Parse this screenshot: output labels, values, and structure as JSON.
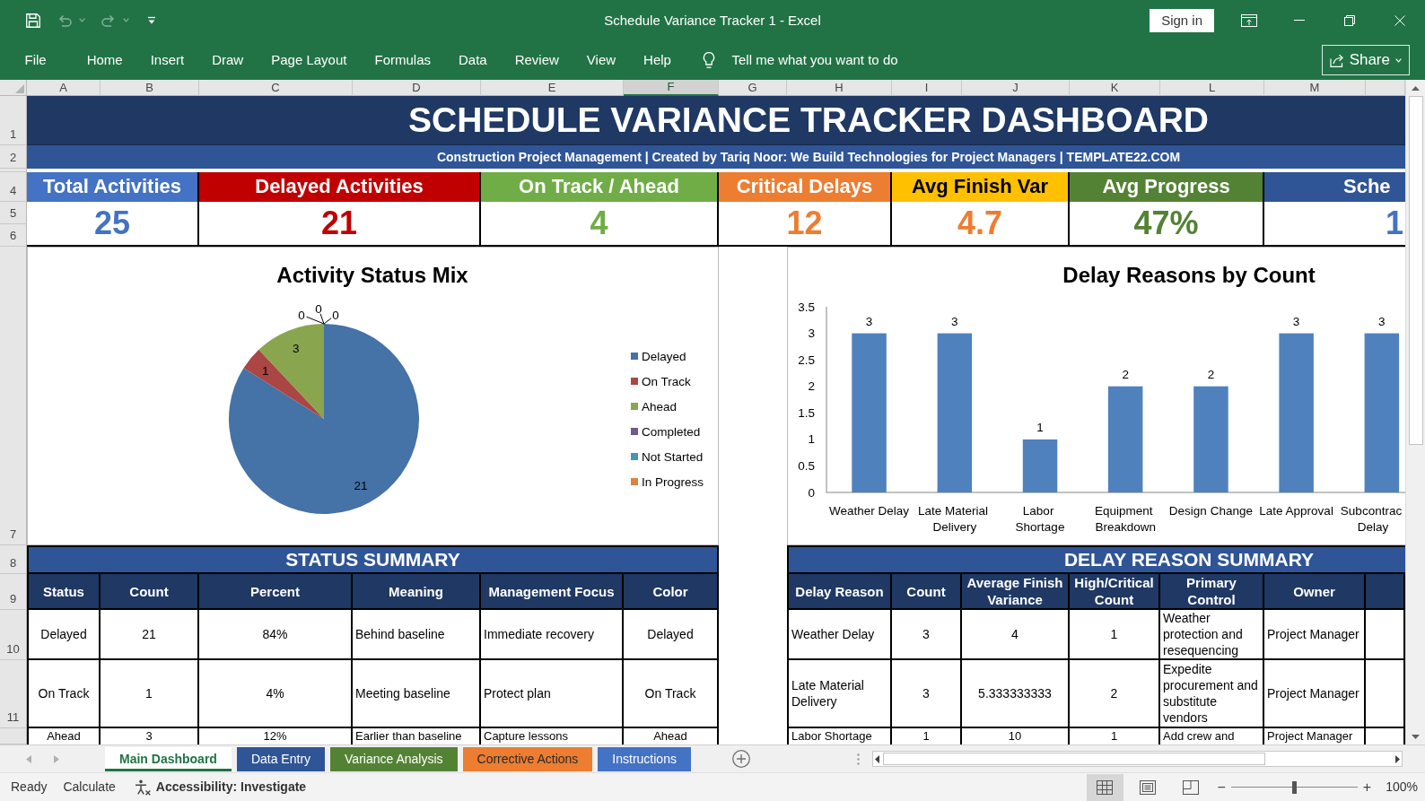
{
  "window": {
    "title": "Schedule Variance Tracker 1 - Excel",
    "sign_in": "Sign in"
  },
  "quick_access": [
    {
      "kind": "save",
      "disabled": false
    },
    {
      "kind": "undo",
      "disabled": true
    },
    {
      "kind": "redo",
      "disabled": true
    },
    {
      "kind": "customize",
      "disabled": false
    }
  ],
  "ribbon": {
    "tabs": [
      "File",
      "Home",
      "Insert",
      "Draw",
      "Page Layout",
      "Formulas",
      "Data",
      "Review",
      "View",
      "Help"
    ],
    "tell_me": "Tell me what you want to do",
    "share": "Share"
  },
  "sheet": {
    "columns": [
      {
        "label": "A",
        "selected": false
      },
      {
        "label": "B",
        "selected": false
      },
      {
        "label": "C",
        "selected": false
      },
      {
        "label": "D",
        "selected": false
      },
      {
        "label": "E",
        "selected": false
      },
      {
        "label": "F",
        "selected": true
      },
      {
        "label": "G",
        "selected": false
      },
      {
        "label": "H",
        "selected": false
      },
      {
        "label": "I",
        "selected": false
      },
      {
        "label": "J",
        "selected": false
      },
      {
        "label": "K",
        "selected": false
      },
      {
        "label": "L",
        "selected": false
      },
      {
        "label": "M",
        "selected": false
      }
    ],
    "row_headers": [
      "1",
      "2",
      "4",
      "5",
      "6",
      "7",
      "8",
      "9",
      "10",
      "11"
    ],
    "title": "SCHEDULE VARIANCE TRACKER DASHBOARD",
    "subtitle": "Construction Project Management | Created by Tariq Noor: We Build Technologies for Project Managers | TEMPLATE22.COM",
    "kpis": [
      {
        "label": "Total Activities",
        "color": "#4472c4",
        "value": {
          "text": "25",
          "color": "#4472c4"
        }
      },
      {
        "label": "Delayed Activities",
        "color": "#c00000",
        "value": {
          "text": "21",
          "color": "#c00000"
        }
      },
      {
        "label": "On Track / Ahead",
        "color": "#70ad47",
        "value": {
          "text": "4",
          "color": "#70ad47"
        }
      },
      {
        "label": "Critical Delays",
        "color": "#ed7d31",
        "value": {
          "text": "12",
          "color": "#ed7d31"
        }
      },
      {
        "label": "Avg Finish Var",
        "color": "#ffc000",
        "value": {
          "text": "4.7",
          "color": "#ed7d31"
        }
      },
      {
        "label": "Avg Progress",
        "color": "#548235",
        "value": {
          "text": "47%",
          "color": "#548235"
        }
      },
      {
        "label": "Sche",
        "color": "#2f5597",
        "value": {
          "text": "1",
          "color": "#4472c4"
        }
      }
    ],
    "pie_chart": {
      "chart_data": {
        "type": "pie",
        "title": "Activity Status Mix",
        "categories": [
          "Delayed",
          "On Track",
          "Ahead",
          "Completed",
          "Not Started",
          "In Progress"
        ],
        "values": [
          21,
          1,
          3,
          0,
          0,
          0
        ],
        "colors": [
          "#4572a7",
          "#aa4643",
          "#89a54e",
          "#71588f",
          "#4198af",
          "#db843d"
        ],
        "data_labels": true,
        "value_labels": [
          "21",
          "1",
          "3",
          "0",
          "0",
          "0"
        ],
        "legend": "right"
      }
    },
    "bar_chart": {
      "chart_data": {
        "type": "bar",
        "title": "Delay Reasons by Count",
        "categories": [
          "Weather Delay",
          "Late Material\nDelivery",
          "Labor\nShortage",
          "Equipment\nBreakdown",
          "Design Change",
          "Late Approval",
          "Subcontrac\nDelay"
        ],
        "series": [
          {
            "color": "#4f81bd",
            "values": [
              3,
              3,
              1,
              2,
              2,
              3,
              3
            ]
          }
        ],
        "ylim": [
          0,
          3.5
        ],
        "yticks": [
          0,
          0.5,
          1,
          1.5,
          2,
          2.5,
          3,
          3.5
        ],
        "data_labels": true,
        "value_labels": [
          "3",
          "3",
          "1",
          "2",
          "2",
          "3",
          "3"
        ]
      }
    },
    "status_summary": {
      "title": "STATUS SUMMARY",
      "columns": [
        "Status",
        "Count",
        "Percent",
        "Meaning",
        "Management Focus",
        "Color"
      ],
      "rows": [
        [
          "Delayed",
          "21",
          "84%",
          "Behind baseline",
          "Immediate recovery",
          "Delayed"
        ],
        [
          "On Track",
          "1",
          "4%",
          "Meeting baseline",
          "Protect plan",
          "On Track"
        ],
        [
          "Ahead",
          "3",
          "12%",
          "Earlier than baseline",
          "Capture lessons",
          "Ahead"
        ]
      ]
    },
    "delay_reason_summary": {
      "title": "DELAY REASON SUMMARY",
      "columns": [
        "Delay Reason",
        "Count",
        "Average Finish Variance",
        "High/Critical Count",
        "Primary Control",
        "Owner"
      ],
      "rows": [
        [
          "Weather Delay",
          "3",
          "4",
          "1",
          "Weather protection and resequencing",
          "Project Manager"
        ],
        [
          "Late Material Delivery",
          "3",
          "5.333333333",
          "2",
          "Expedite procurement and substitute vendors",
          "Project Manager"
        ],
        [
          "Labor Shortage",
          "1",
          "10",
          "1",
          "Add crew and",
          "Project Manager"
        ]
      ]
    }
  },
  "sheet_tabs": [
    {
      "label": "Main Dashboard",
      "selected": true,
      "color": "#217346"
    },
    {
      "label": "Data Entry",
      "selected": false,
      "color": "#2f5597"
    },
    {
      "label": "Variance Analysis",
      "selected": false,
      "color": "#548235"
    },
    {
      "label": "Corrective Actions",
      "selected": false,
      "color": "#ed7d31"
    },
    {
      "label": "Instructions",
      "selected": false,
      "color": "#4472c4"
    }
  ],
  "status_bar": {
    "ready": "Ready",
    "calculate": "Calculate",
    "accessibility": "Accessibility: Investigate",
    "views": [
      {
        "kind": "normal",
        "selected": true
      },
      {
        "kind": "page_layout",
        "selected": false
      },
      {
        "kind": "page_break",
        "selected": false
      }
    ],
    "zoom_out": "−",
    "zoom": {
      "level": 0.5
    },
    "zoom_in": "+",
    "zoom_label": "100%"
  }
}
